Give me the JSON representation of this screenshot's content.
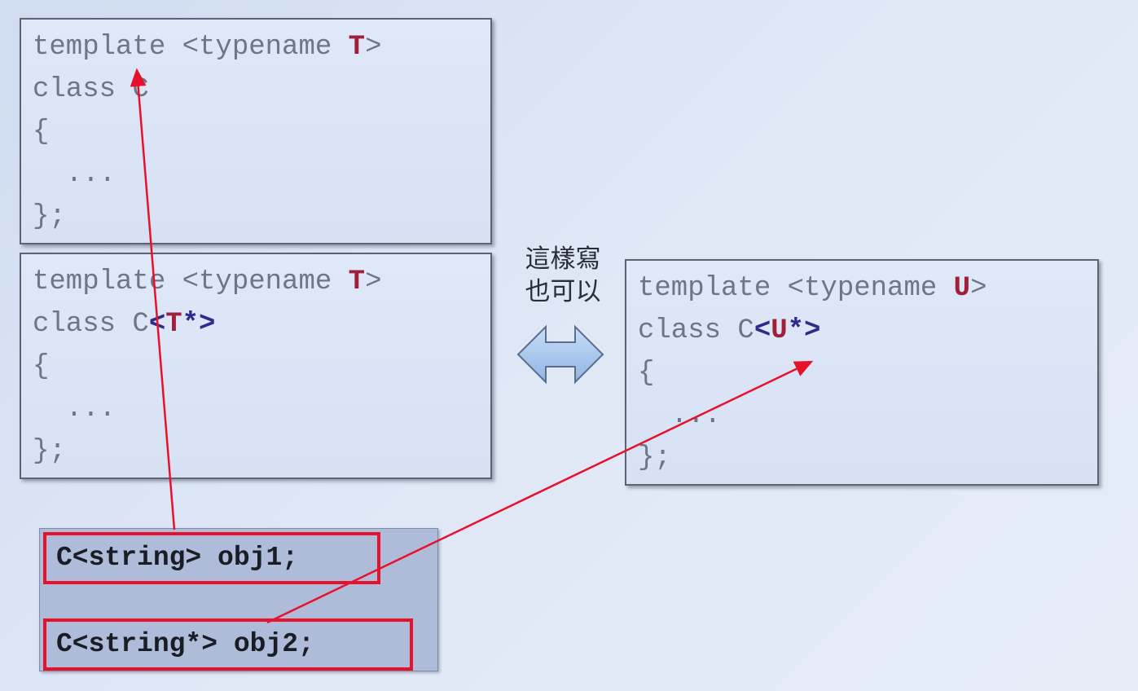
{
  "general_template": {
    "line1_prefix": "template <typename ",
    "line1_param": "T",
    "line1_suffix": ">",
    "line2": "class C",
    "line3": "{",
    "line4": "  ...",
    "line5": "};"
  },
  "partial_spec_t": {
    "line1_prefix": "template <typename ",
    "line1_param": "T",
    "line1_suffix": ">",
    "line2_prefix": "class C",
    "line2_open": "<",
    "line2_param": "T",
    "line2_close": "*>",
    "line3": "{",
    "line4": "  ...",
    "line5": "};"
  },
  "note": {
    "line1": "這樣寫",
    "line2": "也可以"
  },
  "partial_spec_u": {
    "line1_prefix": "template <typename ",
    "line1_param": "U",
    "line1_suffix": ">",
    "line2_prefix": "class C",
    "line2_open": "<",
    "line2_param": "U",
    "line2_close": "*>",
    "line3": "{",
    "line4": "  ...",
    "line5": "};"
  },
  "usage": {
    "obj1": "C<string> obj1;",
    "obj2": "C<string*> obj2;"
  },
  "colors": {
    "highlight_border": "#e8112b",
    "arrow": "#e8112b",
    "param_red": "#a0203a",
    "spec_purple": "#2f2a8c",
    "equiv_arrow_fill": "#a9c9ec"
  }
}
